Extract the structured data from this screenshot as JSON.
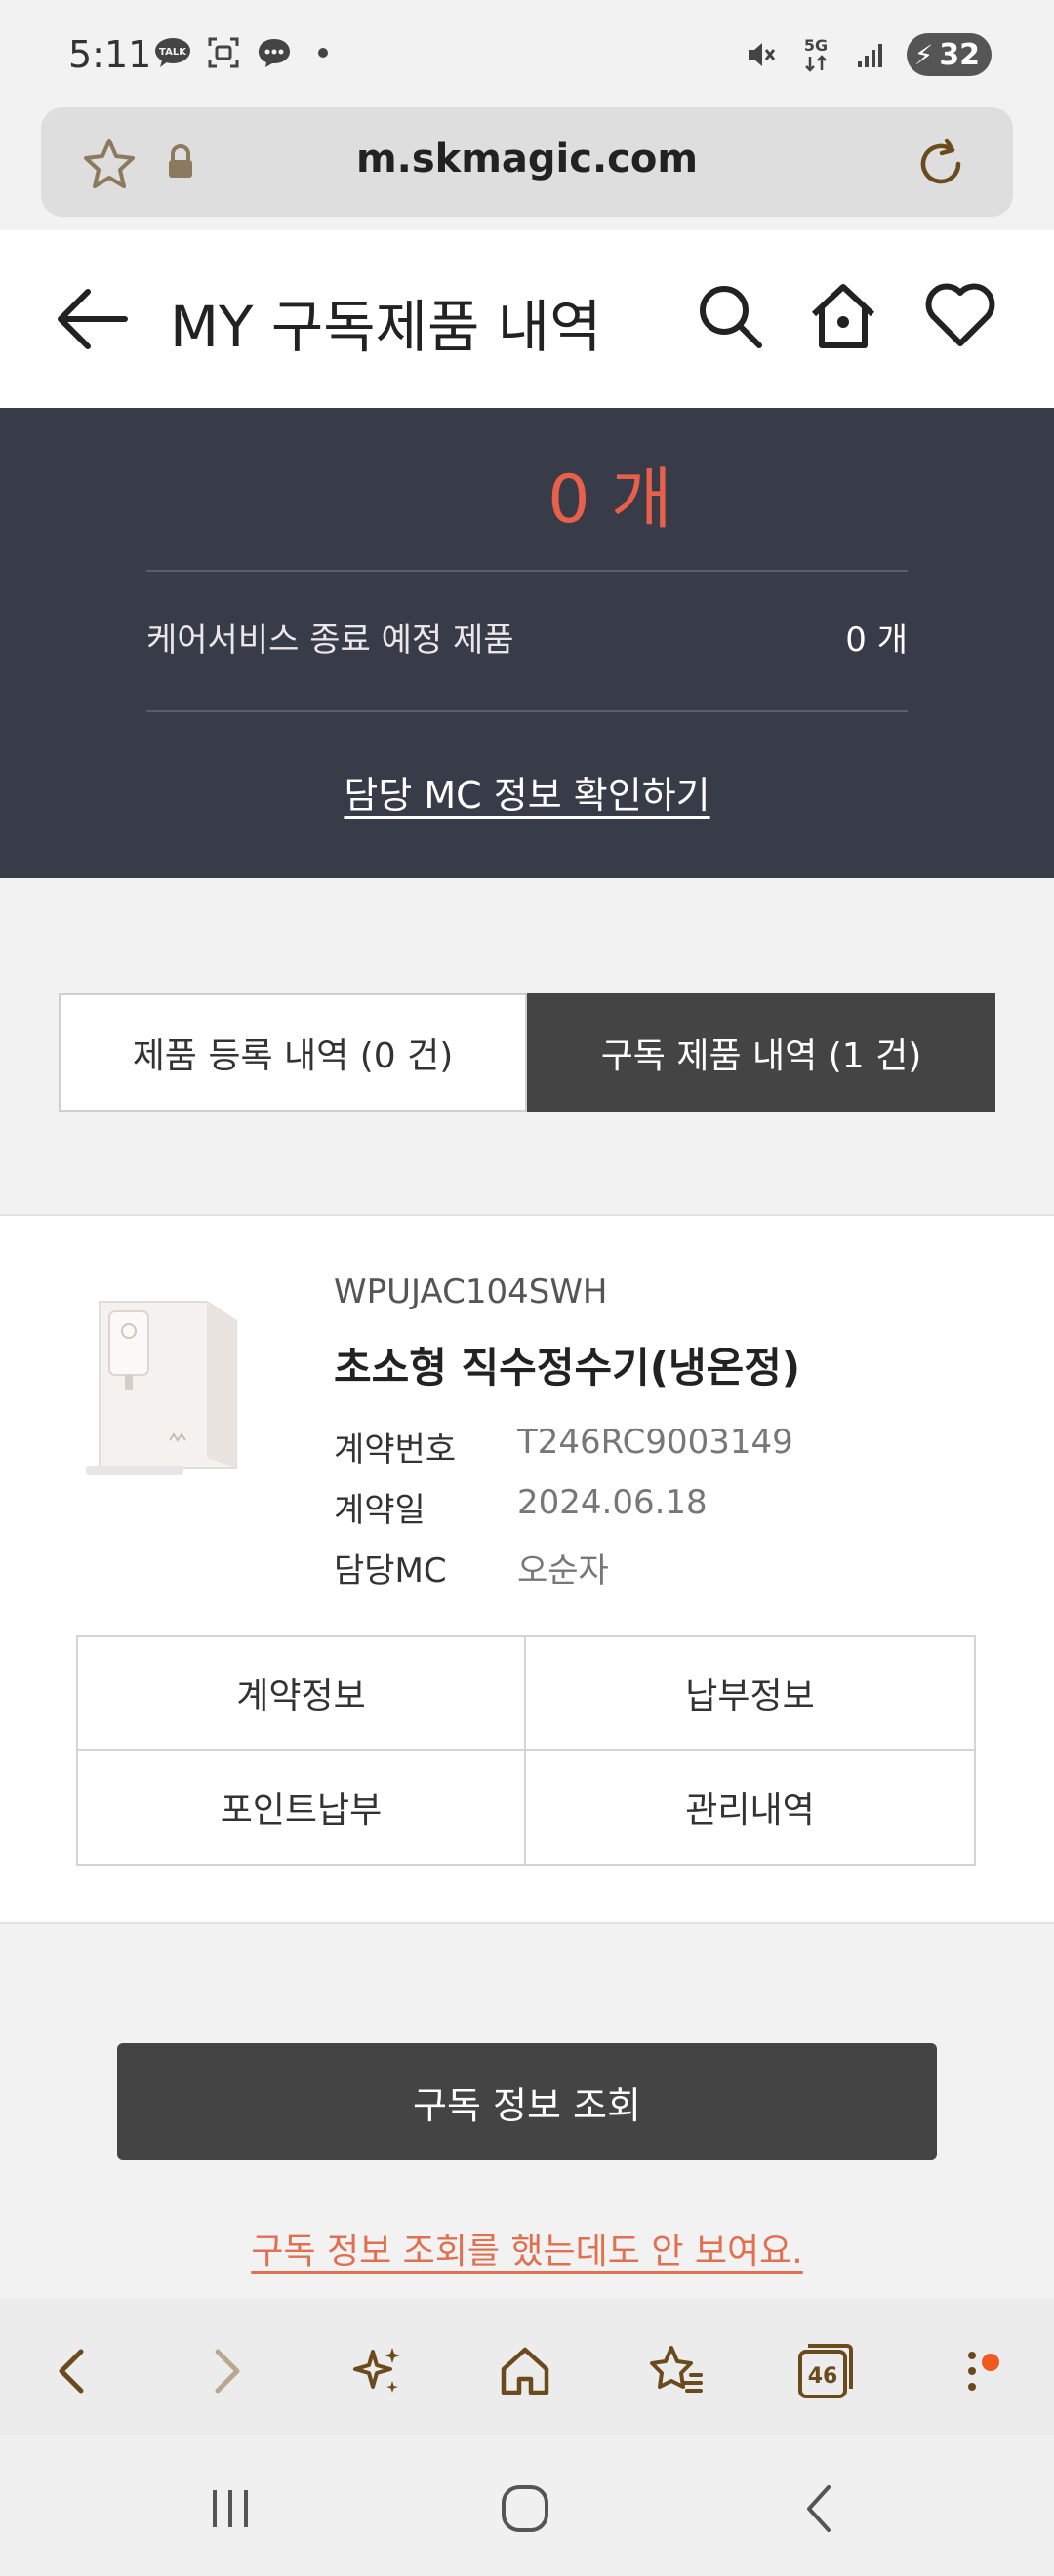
{
  "status_bar": {
    "time": "5:11",
    "left_icons": [
      "talk-icon",
      "screenshot-icon",
      "chat-icon",
      "dot-icon"
    ],
    "right_icons": [
      "mute-icon",
      "5g-icon",
      "signal-icon"
    ],
    "network": "5G",
    "battery": "32"
  },
  "browser": {
    "url": "m.skmagic.com"
  },
  "header": {
    "title": "MY 구독제품 내역"
  },
  "summary": {
    "count": "0 개",
    "ending_label": "케어서비스 종료 예정 제품",
    "ending_value": "0 개",
    "mc_link": "담당 MC 정보 확인하기"
  },
  "tabs": [
    {
      "label": "제품 등록 내역 (0 건)",
      "active": false
    },
    {
      "label": "구독 제품 내역 (1 건)",
      "active": true
    }
  ],
  "product": {
    "model": "WPUJAC104SWH",
    "name": "초소형 직수정수기(냉온정)",
    "info": [
      {
        "label": "계약번호",
        "value": "T246RC9003149"
      },
      {
        "label": "계약일",
        "value": "2024.06.18"
      },
      {
        "label": "담당MC",
        "value": "오순자"
      }
    ],
    "actions": [
      "계약정보",
      "납부정보",
      "포인트납부",
      "관리내역"
    ]
  },
  "cta": {
    "label": "구독 정보 조회",
    "help": "구독 정보 조회를 했는데도 안 보여요."
  },
  "browser_toolbar": {
    "tab_count": "46",
    "colors": {
      "accent": "#6b4a1e",
      "notif": "#f05a22"
    }
  },
  "colors": {
    "summary_bg": "#383b48",
    "count_red": "#e8604a",
    "dark_button": "#444444",
    "link_orange": "#e07050"
  }
}
